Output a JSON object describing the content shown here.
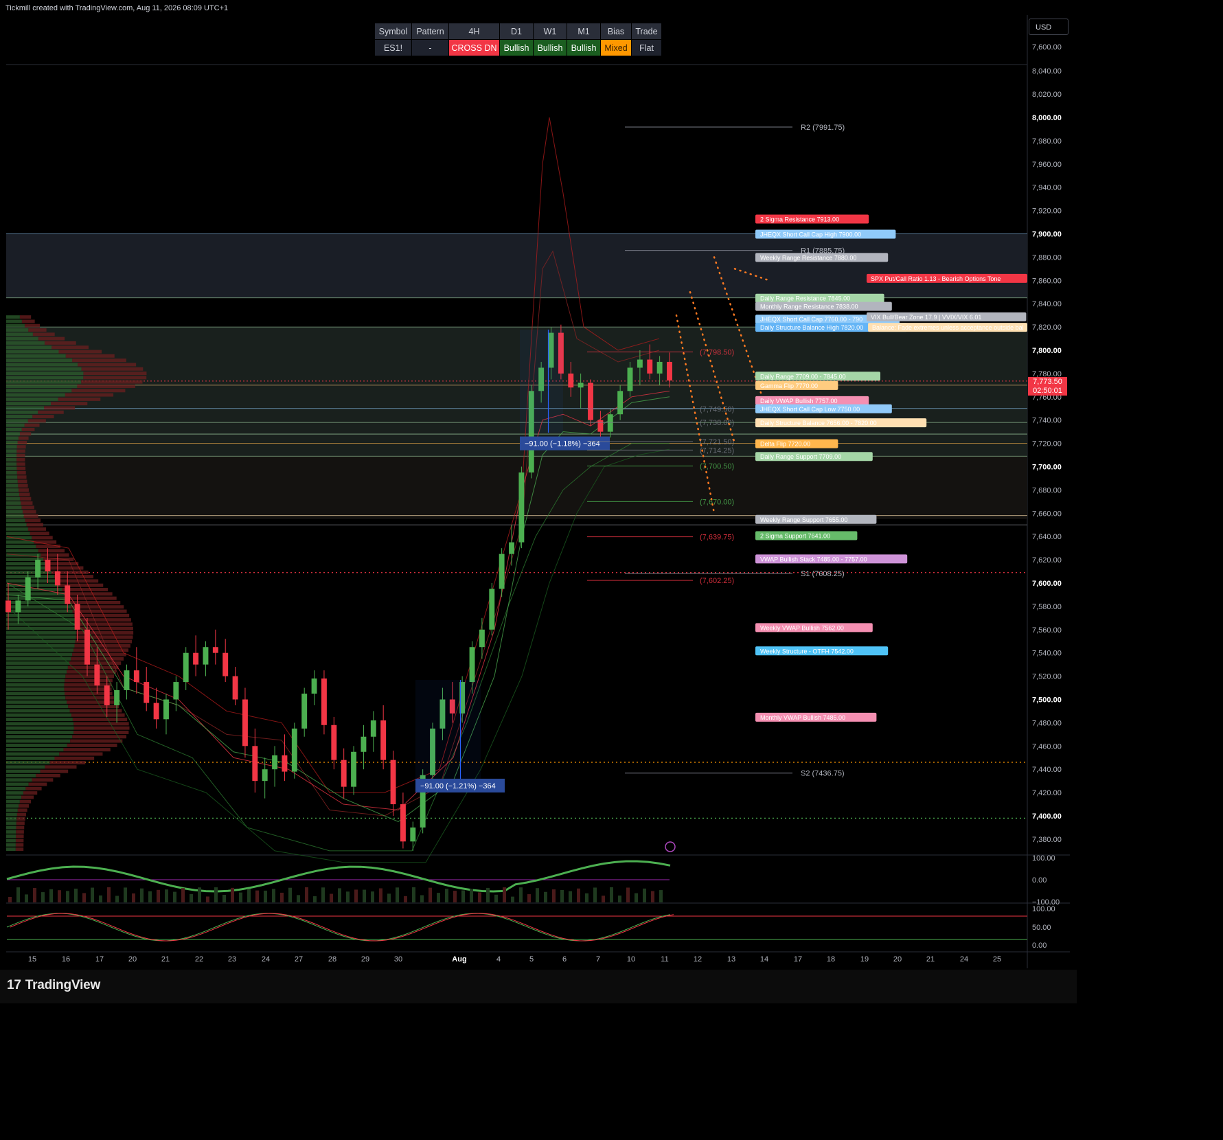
{
  "header": {
    "credit": "Tickmill created with TradingView.com, Aug 11, 2026 08:09 UTC+1",
    "currency": "USD",
    "brand": "TradingView"
  },
  "status_table": {
    "headers": [
      "Symbol",
      "Pattern",
      "4H",
      "D1",
      "W1",
      "M1",
      "Bias",
      "Trade"
    ],
    "values": [
      "ES1!",
      "-",
      "CROSS DN",
      "Bullish",
      "Bullish",
      "Bullish",
      "Mixed",
      "Flat"
    ],
    "value_colors": [
      "#1e222d",
      "#1e222d",
      "#f23645",
      "#1b5e20",
      "#1b5e20",
      "#1b5e20",
      "#ff9800",
      "#1e222d"
    ]
  },
  "colors": {
    "up": "#4caf50",
    "down": "#f23645",
    "background": "#000000",
    "grid": "#131722"
  },
  "price_axis": {
    "ticks": [
      "8,040.00",
      "8,020.00",
      "8,000.00",
      "7,980.00",
      "7,960.00",
      "7,940.00",
      "7,920.00",
      "7,900.00",
      "7,880.00",
      "7,860.00",
      "7,840.00",
      "7,820.00",
      "7,800.00",
      "7,780.00",
      "7,760.00",
      "7,740.00",
      "7,720.00",
      "7,700.00",
      "7,680.00",
      "7,660.00",
      "7,640.00",
      "7,620.00",
      "7,600.00",
      "7,580.00",
      "7,560.00",
      "7,540.00",
      "7,520.00",
      "7,500.00",
      "7,480.00",
      "7,460.00",
      "7,440.00",
      "7,420.00",
      "7,400.00",
      "7,380.00"
    ],
    "top_tick": "7,600.00",
    "current_price": "7,773.50",
    "countdown": "02:50:01"
  },
  "time_axis": {
    "labels": [
      "15",
      "16",
      "17",
      "20",
      "21",
      "22",
      "23",
      "24",
      "27",
      "28",
      "29",
      "30",
      "Aug",
      "4",
      "5",
      "6",
      "7",
      "10",
      "11",
      "12",
      "13",
      "14",
      "17",
      "18",
      "19",
      "20",
      "21",
      "24",
      "25"
    ]
  },
  "chart_data": {
    "type": "candlestick",
    "symbol": "ES1!",
    "timeframe": "4H",
    "ylim": [
      7370,
      8050
    ],
    "last_price": 7773.5,
    "candles": [
      [
        7585,
        7600,
        7560,
        7575
      ],
      [
        7575,
        7590,
        7565,
        7585
      ],
      [
        7585,
        7610,
        7580,
        7605
      ],
      [
        7605,
        7625,
        7595,
        7620
      ],
      [
        7620,
        7630,
        7600,
        7610
      ],
      [
        7610,
        7625,
        7590,
        7598
      ],
      [
        7598,
        7610,
        7575,
        7582
      ],
      [
        7582,
        7590,
        7550,
        7560
      ],
      [
        7560,
        7570,
        7520,
        7530
      ],
      [
        7530,
        7545,
        7505,
        7512
      ],
      [
        7512,
        7520,
        7485,
        7495
      ],
      [
        7495,
        7515,
        7480,
        7508
      ],
      [
        7508,
        7530,
        7500,
        7525
      ],
      [
        7525,
        7545,
        7505,
        7515
      ],
      [
        7515,
        7528,
        7490,
        7497
      ],
      [
        7497,
        7510,
        7475,
        7483
      ],
      [
        7483,
        7505,
        7470,
        7500
      ],
      [
        7500,
        7520,
        7490,
        7515
      ],
      [
        7515,
        7545,
        7508,
        7540
      ],
      [
        7540,
        7555,
        7520,
        7530
      ],
      [
        7530,
        7550,
        7520,
        7545
      ],
      [
        7545,
        7560,
        7530,
        7540
      ],
      [
        7540,
        7552,
        7515,
        7520
      ],
      [
        7520,
        7528,
        7495,
        7500
      ],
      [
        7500,
        7510,
        7450,
        7460
      ],
      [
        7460,
        7475,
        7420,
        7430
      ],
      [
        7430,
        7450,
        7415,
        7440
      ],
      [
        7440,
        7460,
        7425,
        7452
      ],
      [
        7452,
        7470,
        7430,
        7438
      ],
      [
        7438,
        7480,
        7432,
        7475
      ],
      [
        7475,
        7510,
        7468,
        7505
      ],
      [
        7505,
        7525,
        7495,
        7518
      ],
      [
        7518,
        7525,
        7470,
        7478
      ],
      [
        7478,
        7485,
        7440,
        7448
      ],
      [
        7448,
        7458,
        7415,
        7425
      ],
      [
        7425,
        7460,
        7418,
        7455
      ],
      [
        7455,
        7478,
        7440,
        7468
      ],
      [
        7468,
        7490,
        7455,
        7482
      ],
      [
        7482,
        7495,
        7440,
        7448
      ],
      [
        7448,
        7456,
        7400,
        7410
      ],
      [
        7410,
        7420,
        7372,
        7378
      ],
      [
        7378,
        7395,
        7370,
        7390
      ],
      [
        7390,
        7440,
        7385,
        7435
      ],
      [
        7435,
        7480,
        7430,
        7475
      ],
      [
        7475,
        7510,
        7465,
        7500
      ],
      [
        7500,
        7515,
        7480,
        7488
      ],
      [
        7488,
        7520,
        7480,
        7515
      ],
      [
        7515,
        7550,
        7505,
        7545
      ],
      [
        7545,
        7570,
        7535,
        7560
      ],
      [
        7560,
        7600,
        7555,
        7595
      ],
      [
        7595,
        7630,
        7588,
        7625
      ],
      [
        7625,
        7650,
        7615,
        7635
      ],
      [
        7635,
        7700,
        7630,
        7695
      ],
      [
        7695,
        7770,
        7690,
        7765
      ],
      [
        7765,
        7790,
        7755,
        7785
      ],
      [
        7785,
        7820,
        7775,
        7815
      ],
      [
        7815,
        7822,
        7775,
        7780
      ],
      [
        7780,
        7790,
        7760,
        7768
      ],
      [
        7768,
        7780,
        7750,
        7772
      ],
      [
        7772,
        7775,
        7735,
        7740
      ],
      [
        7740,
        7748,
        7725,
        7730
      ],
      [
        7730,
        7750,
        7725,
        7745
      ],
      [
        7745,
        7770,
        7740,
        7765
      ],
      [
        7765,
        7790,
        7760,
        7785
      ],
      [
        7785,
        7800,
        7770,
        7792
      ],
      [
        7792,
        7805,
        7775,
        7780
      ],
      [
        7780,
        7795,
        7770,
        7790
      ],
      [
        7790,
        7798,
        7768,
        7774
      ]
    ],
    "pivots": [
      {
        "label": "R2 (7991.75)",
        "value": 7991.75
      },
      {
        "label": "R1 (7885.75)",
        "value": 7885.75
      },
      {
        "label": "S1 (7608.25)",
        "value": 7608.25
      },
      {
        "label": "S2 (7436.75)",
        "value": 7436.75
      }
    ],
    "projection_levels": [
      {
        "label": "(7,798.50)",
        "value": 7798.5,
        "color": "#f23645"
      },
      {
        "label": "(7,749.50)",
        "value": 7749.5,
        "color": "#787b86"
      },
      {
        "label": "(7,738.00)",
        "value": 7738.0,
        "color": "#787b86"
      },
      {
        "label": "(7,721.50)",
        "value": 7721.5,
        "color": "#787b86"
      },
      {
        "label": "(7,714.25)",
        "value": 7714.25,
        "color": "#787b86"
      },
      {
        "label": "(7,700.50)",
        "value": 7700.5,
        "color": "#4caf50"
      },
      {
        "label": "(7,670.00)",
        "value": 7670.0,
        "color": "#4caf50"
      },
      {
        "label": "(7,639.75)",
        "value": 7639.75,
        "color": "#f23645"
      },
      {
        "label": "(7,602.25)",
        "value": 7602.25,
        "color": "#f23645"
      }
    ],
    "level_tags": [
      {
        "label": "2 Sigma Resistance  7913.00",
        "value": 7913.0,
        "color": "#f23645"
      },
      {
        "label": "JHEQX Short Call Cap High  7900.00",
        "value": 7900.0,
        "color": "#90caf9"
      },
      {
        "label": "Weekly Range Resistance  7880.00",
        "value": 7880.0,
        "color": "#b2b5be"
      },
      {
        "label": "Daily Range Resistance  7845.00",
        "value": 7845.0,
        "color": "#a5d6a7"
      },
      {
        "label": "Monthly Range Resistance  7838.00",
        "value": 7838.0,
        "color": "#b2b5be"
      },
      {
        "label": "JHEQX Short Call Cap  7760.00 - 790",
        "value": 7827.0,
        "color": "#90caf9"
      },
      {
        "label": "Daily Structure Balance High  7820.00",
        "value": 7820.0,
        "color": "#64b5f6"
      },
      {
        "label": "Daily Range  7709.00 - 7845.00",
        "value": 7778.0,
        "color": "#a5d6a7"
      },
      {
        "label": "Gamma Flip  7770.00",
        "value": 7770.0,
        "color": "#ffcc80"
      },
      {
        "label": "Daily VWAP Bullish  7757.00",
        "value": 7757.0,
        "color": "#f48fb1"
      },
      {
        "label": "JHEQX Short Call Cap Low  7750.00",
        "value": 7750.0,
        "color": "#90caf9"
      },
      {
        "label": "Daily Structure Balance  7656.00 - 7820.00",
        "value": 7738.0,
        "color": "#ffe0b2"
      },
      {
        "label": "Delta Flip  7720.00",
        "value": 7720.0,
        "color": "#ffb74d"
      },
      {
        "label": "Daily Range Support  7709.00",
        "value": 7709.0,
        "color": "#a5d6a7"
      },
      {
        "label": "Weekly Range Support  7655.00",
        "value": 7655.0,
        "color": "#b2b5be"
      },
      {
        "label": "2 Sigma Support  7641.00",
        "value": 7641.0,
        "color": "#66bb6a"
      },
      {
        "label": "VWAP Bullish Stack  7485.00 - 7757.00",
        "value": 7621.0,
        "color": "#ce93d8"
      },
      {
        "label": "Weekly VWAP Bullish  7562.00",
        "value": 7562.0,
        "color": "#f48fb1"
      },
      {
        "label": "Weekly Structure - OTFH  7542.00",
        "value": 7542.0,
        "color": "#4fc3f7"
      },
      {
        "label": "Monthly VWAP Bullish  7485.00",
        "value": 7485.0,
        "color": "#f48fb1"
      }
    ],
    "side_notes": [
      {
        "label": "SPX Put/Call Ratio 1.13 - Bearish Options Tone",
        "value": 7862.0,
        "color": "#f23645"
      },
      {
        "label": "VIX Bull/Bear Zone 17.9 | VVIX/VIX 6.01",
        "value": 7829.0,
        "color": "#b2b5be"
      },
      {
        "label": "Balance: Fade extremes unless acceptance outside bal",
        "value": 7820.0,
        "color": "#ffe0b2"
      }
    ],
    "measures": [
      {
        "label": "−91.00 (−1.18%) −364",
        "y": 7720
      },
      {
        "label": "−91.00 (−1.21%) −364",
        "y": 7426
      }
    ],
    "oscillator_1": {
      "ticks": [
        "100.00",
        "0.00",
        "−100.00"
      ]
    },
    "oscillator_2": {
      "ticks": [
        "100.00",
        "50.00",
        "0.00"
      ]
    }
  }
}
